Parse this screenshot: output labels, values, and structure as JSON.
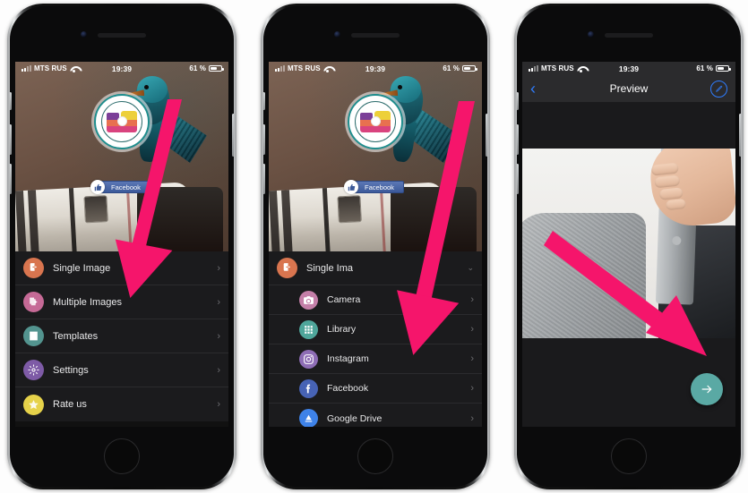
{
  "meta": {
    "accent_pink": "#F5156B",
    "accent_teal": "#5AA9A4",
    "ios_blue": "#2F7DFF"
  },
  "status_bar": {
    "carrier": "MTS RUS",
    "time": "19:39",
    "battery": "61 %",
    "signal_icon": "signal-bars-icon",
    "wifi_icon": "wifi-icon",
    "battery_icon": "battery-icon"
  },
  "phones": [
    {
      "id": "phone-1",
      "screen": "main-menu",
      "hero": {
        "logo_icon": "app-camera-logo-icon",
        "facebook_like": {
          "label": "Facebook",
          "icon": "thumbs-up-icon"
        }
      },
      "menu": [
        {
          "label": "Single Image",
          "icon": "add-single-image-icon",
          "color": "#D9754F",
          "chevron": "›"
        },
        {
          "label": "Multiple Images",
          "icon": "add-multiple-images-icon",
          "color": "#C66A96",
          "chevron": "›"
        },
        {
          "label": "Templates",
          "icon": "templates-icon",
          "color": "#53948F",
          "chevron": "›"
        },
        {
          "label": "Settings",
          "icon": "settings-gear-icon",
          "color": "#7E5BA6",
          "chevron": "›"
        },
        {
          "label": "Rate us",
          "icon": "star-rate-icon",
          "color": "#E6D24A",
          "chevron": "›"
        }
      ],
      "annotation_arrow": "arrow-to-single-image"
    },
    {
      "id": "phone-2",
      "screen": "single-image-sources",
      "hero": {
        "logo_icon": "app-camera-logo-icon",
        "facebook_like": {
          "label": "Facebook",
          "icon": "thumbs-up-icon"
        }
      },
      "parent_row": {
        "label": "Single Ima",
        "icon": "add-single-image-icon",
        "color": "#D9754F",
        "chevron": "⌄"
      },
      "menu": [
        {
          "label": "Camera",
          "icon": "camera-icon",
          "color": "#C47FA8",
          "chevron": "›"
        },
        {
          "label": "Library",
          "icon": "grid-library-icon",
          "color": "#4FA69B",
          "chevron": "›"
        },
        {
          "label": "Instagram",
          "icon": "instagram-icon",
          "color": "#8E6DB5",
          "chevron": "›"
        },
        {
          "label": "Facebook",
          "icon": "facebook-icon",
          "color": "#4763B5",
          "chevron": "›"
        },
        {
          "label": "Google Drive",
          "icon": "google-drive-icon",
          "color": "#3E82E8",
          "chevron": "›"
        }
      ],
      "annotation_arrow": "arrow-to-camera"
    },
    {
      "id": "phone-3",
      "screen": "preview",
      "navbar": {
        "back_icon": "back-chevron-icon",
        "title": "Preview",
        "edit_icon": "pencil-edit-icon"
      },
      "photo_alt": "hand-placing-laptop-into-sleeve-photo",
      "next_button": {
        "icon": "arrow-right-icon"
      },
      "annotation_arrow": "arrow-to-next-button"
    }
  ]
}
